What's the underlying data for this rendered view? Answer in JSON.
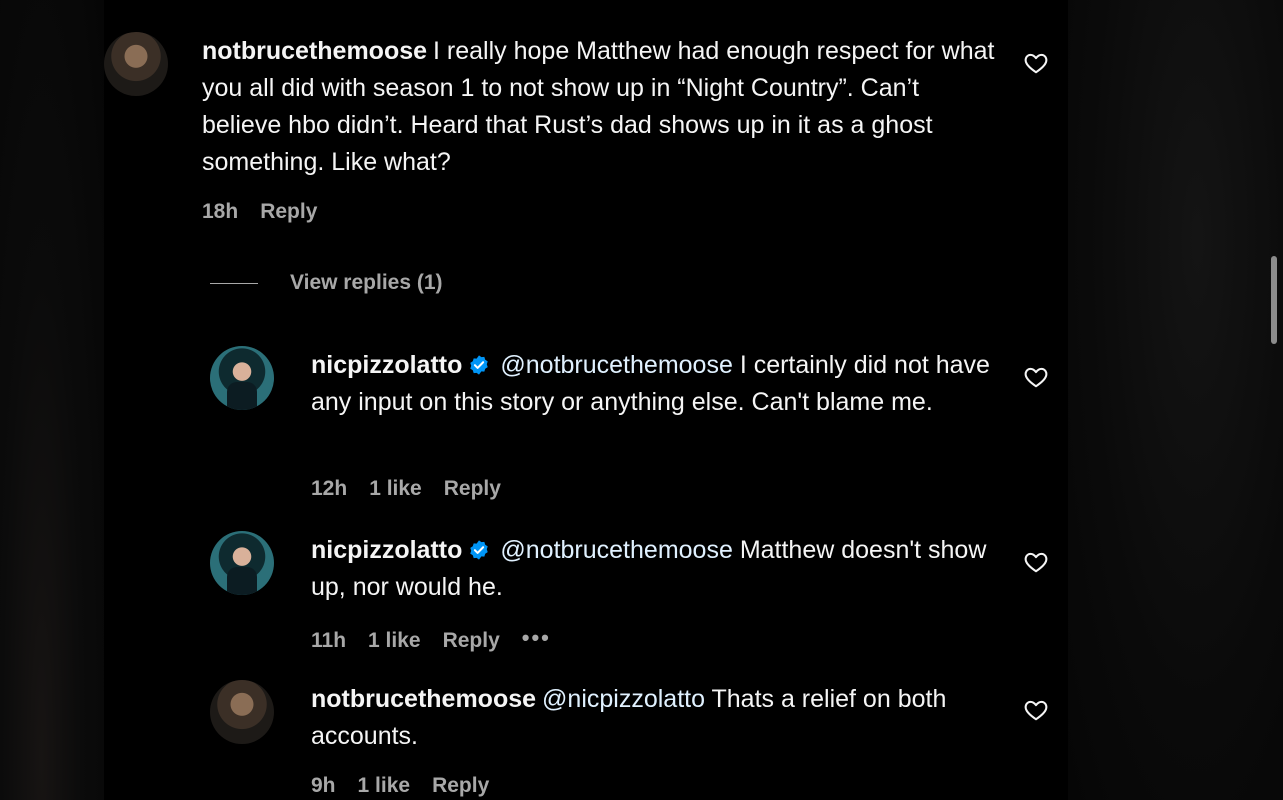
{
  "comments": [
    {
      "username": "notbrucethemoose",
      "mention": "",
      "text": "I really hope Matthew had enough respect for what you all did with season 1 to not show up in “Night Country”. Can’t believe hbo didn’t. Heard that Rust’s dad shows up in it as a ghost something. Like what?",
      "time": "18h",
      "likes": "",
      "reply_label": "Reply"
    },
    {
      "username": "nicpizzolatto",
      "mention": "@notbrucethemoose",
      "text": "I certainly did not have any input on this story or anything else. Can't blame me.",
      "time": "12h",
      "likes": "1 like",
      "reply_label": "Reply"
    },
    {
      "username": "nicpizzolatto",
      "mention": "@notbrucethemoose",
      "text": "Matthew doesn't show up, nor would he.",
      "time": "11h",
      "likes": "1 like",
      "reply_label": "Reply",
      "more_label": "•••"
    },
    {
      "username": "notbrucethemoose",
      "mention": "@nicpizzolatto",
      "text": "Thats a relief on both accounts.",
      "time": "9h",
      "likes": "1 like",
      "reply_label": "Reply"
    }
  ],
  "view_replies_label": "View replies (1)",
  "icons": {
    "heart": "heart-outline-icon",
    "verified": "verified-badge-icon",
    "more": "more-options-icon"
  },
  "colors": {
    "background": "#000000",
    "primary_text": "#f5f5f5",
    "secondary_text": "#a8a8a8",
    "verified": "#0095f6"
  }
}
